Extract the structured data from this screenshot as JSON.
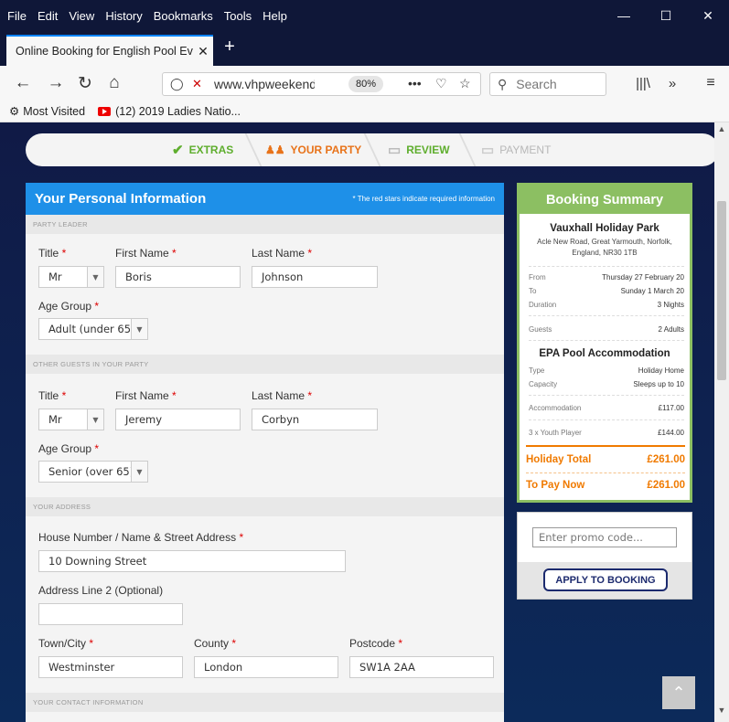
{
  "menubar": {
    "items": [
      "File",
      "Edit",
      "View",
      "History",
      "Bookmarks",
      "Tools",
      "Help"
    ],
    "window_controls": [
      "—",
      "☐",
      "✕"
    ]
  },
  "tab": {
    "title": "Online Booking for English Pool Eve",
    "close": "✕",
    "new_tab": "+"
  },
  "navbar": {
    "url": "www.vhpweekend",
    "zoom": "80%",
    "search_placeholder": "Search",
    "more": "•••"
  },
  "bookmarks": [
    {
      "icon": "gear-icon",
      "label": "Most Visited"
    },
    {
      "icon": "youtube-icon",
      "label": "(12) 2019 Ladies Natio..."
    }
  ],
  "steps": [
    {
      "label": "EXTRAS",
      "color": "#5fae2e",
      "icon": "✔"
    },
    {
      "label": "YOUR PARTY",
      "color": "#e8731a",
      "icon": "👥"
    },
    {
      "label": "REVIEW",
      "color": "#5fae2e",
      "icon": "▭"
    },
    {
      "label": "PAYMENT",
      "color": "#b8b8b8",
      "icon": "▭"
    }
  ],
  "form": {
    "title": "Your Personal Information",
    "note": "* The red stars indicate required information",
    "sections": {
      "party_leader": "PARTY LEADER",
      "other_guests": "OTHER GUESTS IN YOUR PARTY",
      "address": "YOUR ADDRESS",
      "contact": "YOUR CONTACT INFORMATION"
    },
    "labels": {
      "title": "Title",
      "first_name": "First Name",
      "last_name": "Last Name",
      "age_group": "Age Group",
      "street": "House Number / Name & Street Address",
      "address2": "Address Line 2 (Optional)",
      "town": "Town/City",
      "county": "County",
      "postcode": "Postcode",
      "req": "*"
    },
    "leader": {
      "title": "Mr",
      "first_name": "Boris",
      "last_name": "Johnson",
      "age_group": "Adult (under 65)"
    },
    "guest": {
      "title": "Mr",
      "first_name": "Jeremy",
      "last_name": "Corbyn",
      "age_group": "Senior (over 65)"
    },
    "address": {
      "street": "10 Downing Street",
      "address2": "",
      "town": "Westminster",
      "county": "London",
      "postcode": "SW1A 2AA"
    }
  },
  "summary": {
    "title": "Booking Summary",
    "park": "Vauxhall Holiday Park",
    "address": "Acle New Road, Great Yarmouth, Norfolk, England, NR30 1TB",
    "from_label": "From",
    "from": "Thursday 27 February 20",
    "to_label": "To",
    "to": "Sunday 1 March 20",
    "duration_label": "Duration",
    "duration": "3 Nights",
    "guests_label": "Guests",
    "guests": "2 Adults",
    "accommodation_title": "EPA Pool Accommodation",
    "type_label": "Type",
    "type": "Holiday Home",
    "capacity_label": "Capacity",
    "capacity": "Sleeps up to 10",
    "acc_label": "Accommodation",
    "acc_price": "£117.00",
    "youth_label": "3 x Youth Player",
    "youth_price": "£144.00",
    "total_label": "Holiday Total",
    "total": "£261.00",
    "pay_label": "To Pay Now",
    "pay": "£261.00"
  },
  "promo": {
    "placeholder": "Enter promo code...",
    "button": "APPLY TO BOOKING"
  },
  "colors": {
    "accent_blue": "#1e90e8",
    "summary_green": "#8cbf62",
    "orange": "#f07a00",
    "navy": "#101a46"
  }
}
